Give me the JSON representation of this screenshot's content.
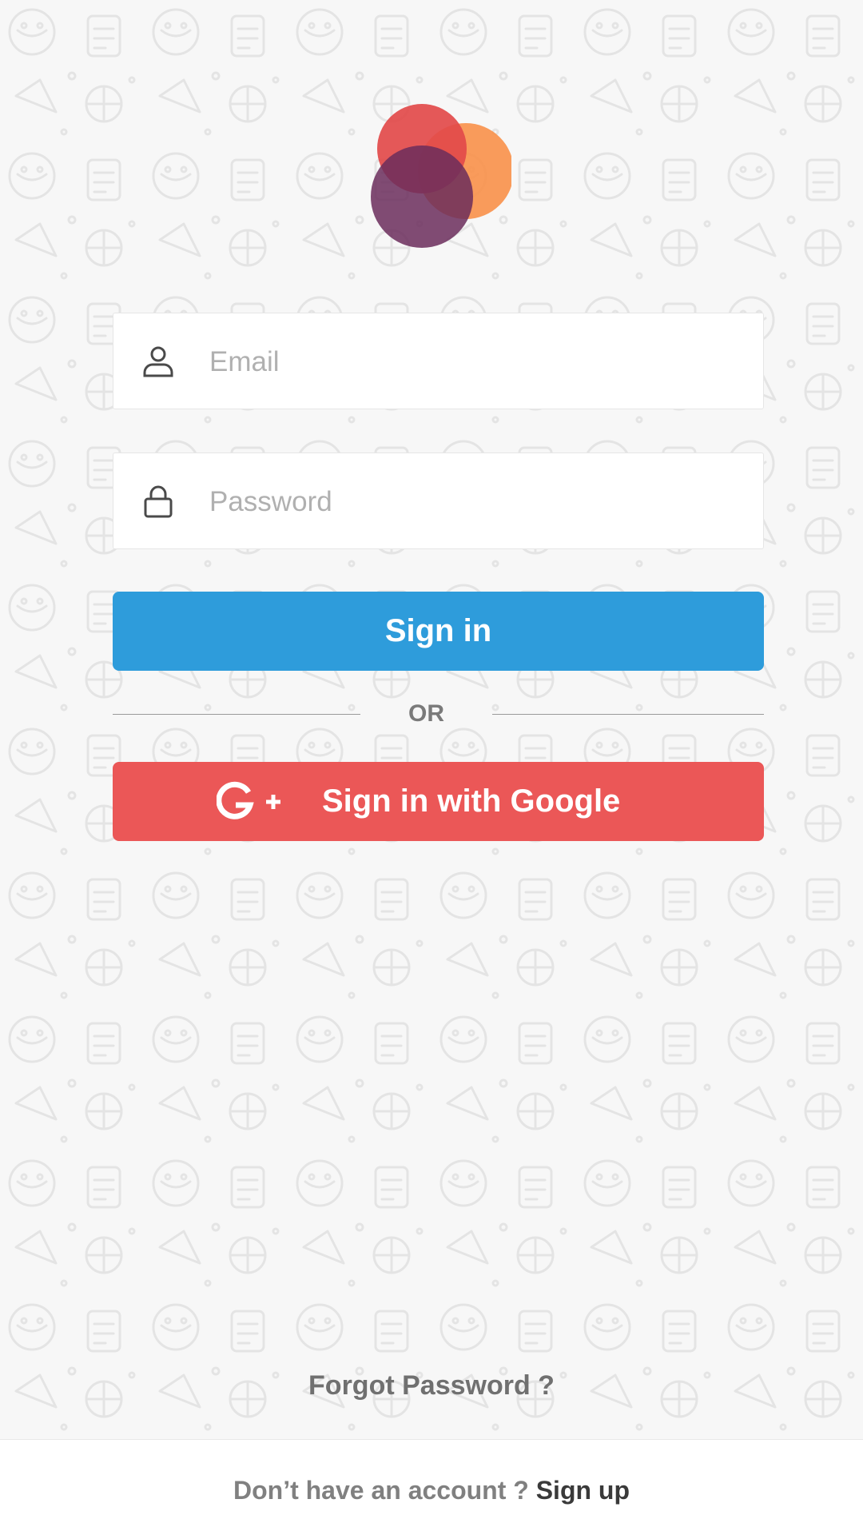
{
  "colors": {
    "accent_blue": "#2e9cdb",
    "google_red": "#eb5757",
    "background": "#f7f7f7",
    "logo_red": "#e24a4a",
    "logo_orange": "#f8924d",
    "logo_purple": "#6b2d5c"
  },
  "icons": {
    "logo": "overlapping-circles-logo",
    "email": "user-icon",
    "password": "lock-icon",
    "google": "google-plus-icon"
  },
  "form": {
    "email_placeholder": "Email",
    "password_placeholder": "Password",
    "signin_label": "Sign in",
    "or_label": "OR",
    "google_label": "Sign in with Google"
  },
  "forgot_password": "Forgot Password ?",
  "footer": {
    "prompt": "Don’t have an account ?",
    "signup_label": "Sign up"
  }
}
